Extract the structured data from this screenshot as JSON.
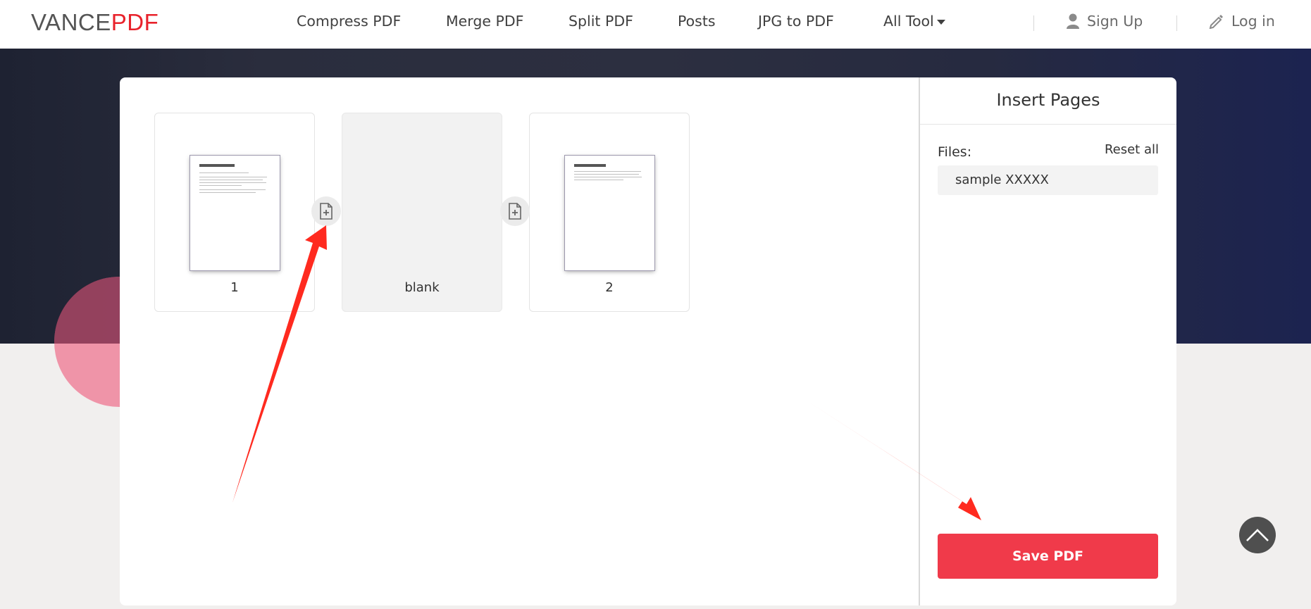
{
  "header": {
    "logo_part1": "VANCE",
    "logo_part2": "PDF",
    "nav": [
      {
        "label": "Compress PDF"
      },
      {
        "label": "Merge PDF"
      },
      {
        "label": "Split PDF"
      },
      {
        "label": "Posts"
      },
      {
        "label": "JPG to PDF"
      },
      {
        "label": "All Tool"
      }
    ],
    "sign_up": "Sign Up",
    "log_in": "Log in"
  },
  "pages": [
    {
      "label": "1"
    },
    {
      "label": "blank"
    },
    {
      "label": "2"
    }
  ],
  "sidebar": {
    "title": "Insert Pages",
    "files_label": "Files:",
    "reset_all": "Reset all",
    "file_name": "sample XXXXX",
    "save_button": "Save PDF"
  },
  "colors": {
    "brand_red": "#e8222b",
    "save_button": "#f03a4a",
    "annotation_arrow": "#ff2a1f"
  },
  "icons": {
    "add_page": "file-plus-icon",
    "user": "user-icon",
    "edit": "pencil-icon",
    "scroll_top": "chevron-up-icon"
  }
}
